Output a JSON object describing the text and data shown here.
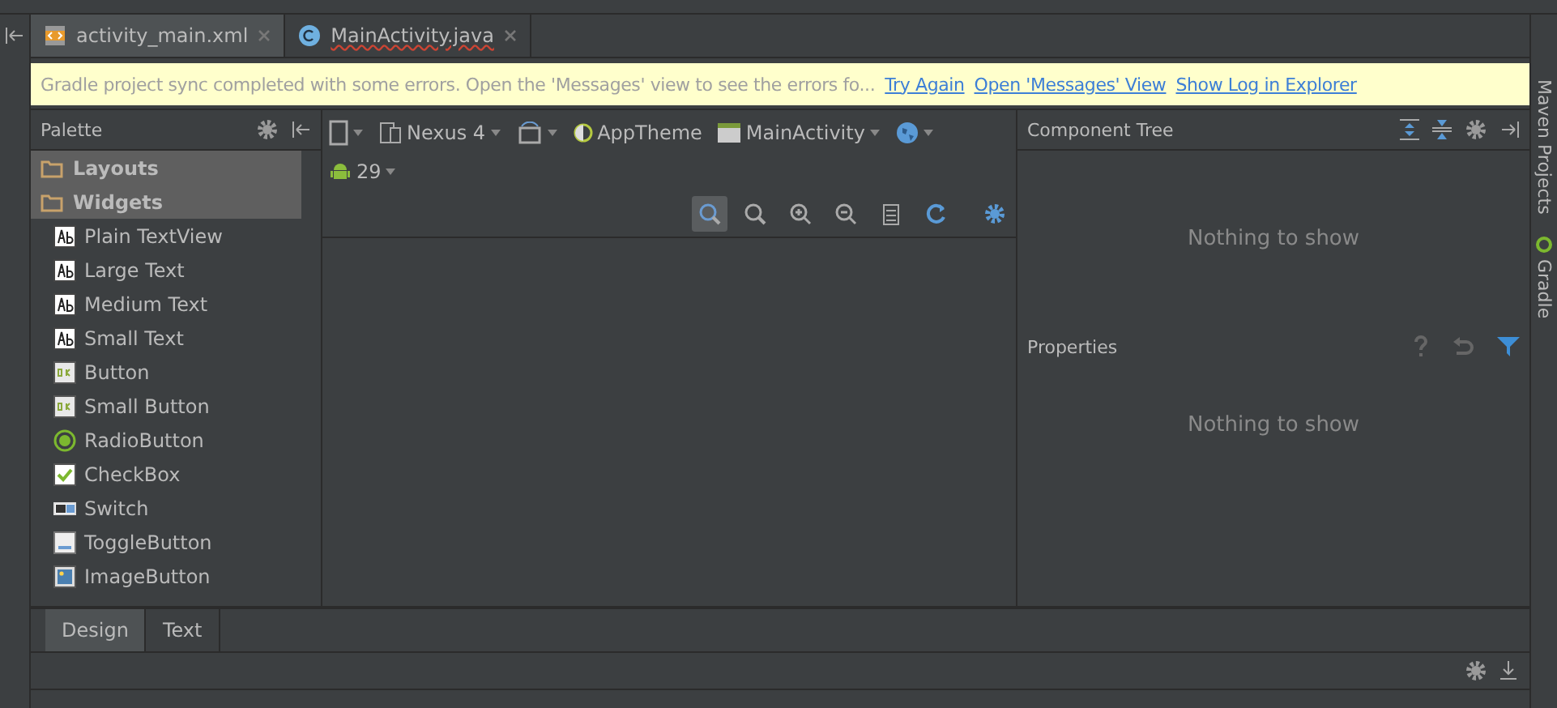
{
  "editor_tabs": [
    {
      "label": "activity_main.xml",
      "kind": "xml",
      "selected": true
    },
    {
      "label": "MainActivity.java",
      "kind": "java",
      "selected": false
    }
  ],
  "banner": {
    "message": "Gradle project sync completed with some errors. Open the 'Messages' view to see the errors fo...",
    "links": [
      "Try Again",
      "Open 'Messages' View",
      "Show Log in Explorer"
    ]
  },
  "palette": {
    "title": "Palette",
    "groups": [
      "Layouts",
      "Widgets"
    ],
    "items": [
      {
        "label": "Plain TextView",
        "kind": "text"
      },
      {
        "label": "Large Text",
        "kind": "text"
      },
      {
        "label": "Medium Text",
        "kind": "text"
      },
      {
        "label": "Small Text",
        "kind": "text"
      },
      {
        "label": "Button",
        "kind": "button"
      },
      {
        "label": "Small Button",
        "kind": "button"
      },
      {
        "label": "RadioButton",
        "kind": "radio"
      },
      {
        "label": "CheckBox",
        "kind": "check"
      },
      {
        "label": "Switch",
        "kind": "switch"
      },
      {
        "label": "ToggleButton",
        "kind": "toggle"
      },
      {
        "label": "ImageButton",
        "kind": "image"
      }
    ]
  },
  "designer_toolbar": {
    "device": "Nexus 4",
    "theme": "AppTheme",
    "activity": "MainActivity",
    "api": "29"
  },
  "component_tree": {
    "title": "Component Tree",
    "empty": "Nothing to show"
  },
  "properties": {
    "title": "Properties",
    "empty": "Nothing to show"
  },
  "side_tools": [
    "Maven Projects",
    "Gradle"
  ],
  "bottom_tabs": [
    {
      "label": "Design",
      "selected": true
    },
    {
      "label": "Text",
      "selected": false
    }
  ]
}
